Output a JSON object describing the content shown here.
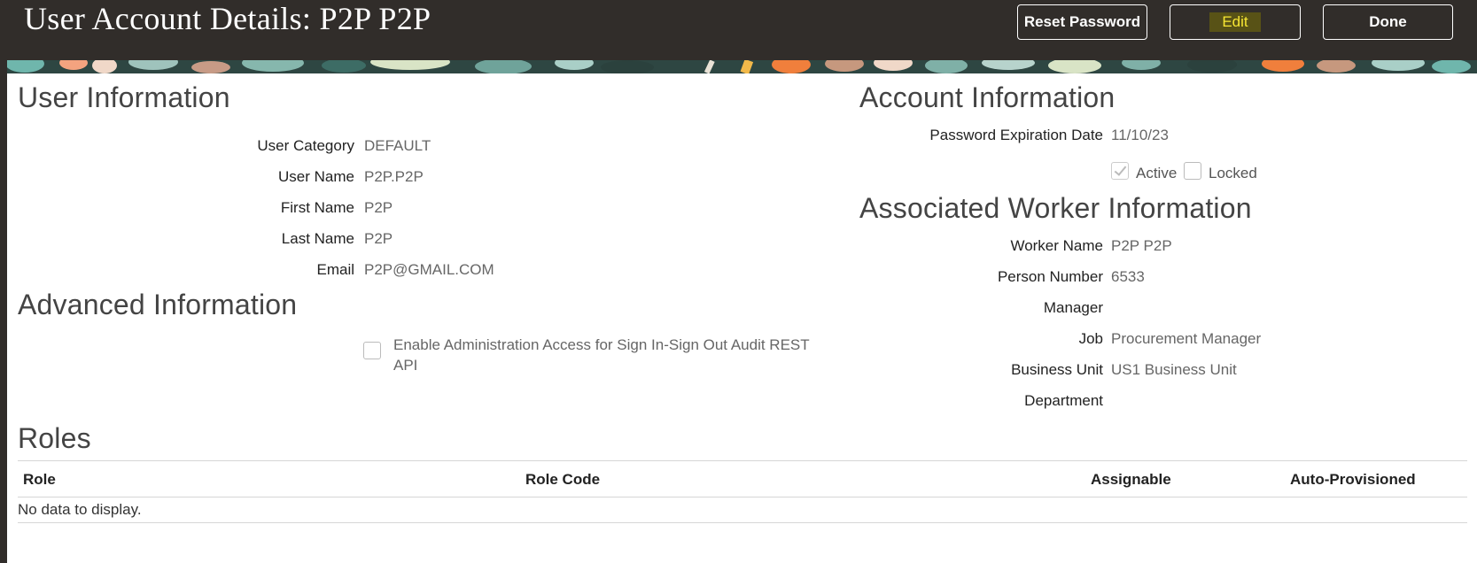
{
  "header": {
    "title": "User Account Details: P2P P2P",
    "buttons": {
      "reset_password": "Reset Password",
      "edit": "Edit",
      "done": "Done"
    }
  },
  "user_information": {
    "heading": "User Information",
    "fields": [
      {
        "label": "User Category",
        "value": "DEFAULT"
      },
      {
        "label": "User Name",
        "value": "P2P.P2P"
      },
      {
        "label": "First Name",
        "value": "P2P"
      },
      {
        "label": "Last Name",
        "value": "P2P"
      },
      {
        "label": "Email",
        "value": "P2P@GMAIL.COM"
      }
    ]
  },
  "advanced_information": {
    "heading": "Advanced Information",
    "checkbox_label_line1": "Enable Administration Access for Sign In-Sign Out Audit REST",
    "checkbox_label_line2": "API",
    "checked": false
  },
  "account_information": {
    "heading": "Account Information",
    "password_expiration_label": "Password Expiration Date",
    "password_expiration_value": "11/10/23",
    "active_label": "Active",
    "active_checked": true,
    "locked_label": "Locked",
    "locked_checked": false
  },
  "worker_information": {
    "heading": "Associated Worker Information",
    "fields": [
      {
        "label": "Worker Name",
        "value": "P2P P2P"
      },
      {
        "label": "Person Number",
        "value": "6533"
      },
      {
        "label": "Manager",
        "value": ""
      },
      {
        "label": "Job",
        "value": "Procurement Manager"
      },
      {
        "label": "Business Unit",
        "value": "US1 Business Unit"
      },
      {
        "label": "Department",
        "value": ""
      }
    ]
  },
  "roles": {
    "heading": "Roles",
    "columns": [
      "Role",
      "Role Code",
      "Assignable",
      "Auto-Provisioned"
    ],
    "empty_message": "No data to display."
  },
  "colors": {
    "header_bg": "#312d2a",
    "edit_highlight_text": "#f7e633"
  }
}
